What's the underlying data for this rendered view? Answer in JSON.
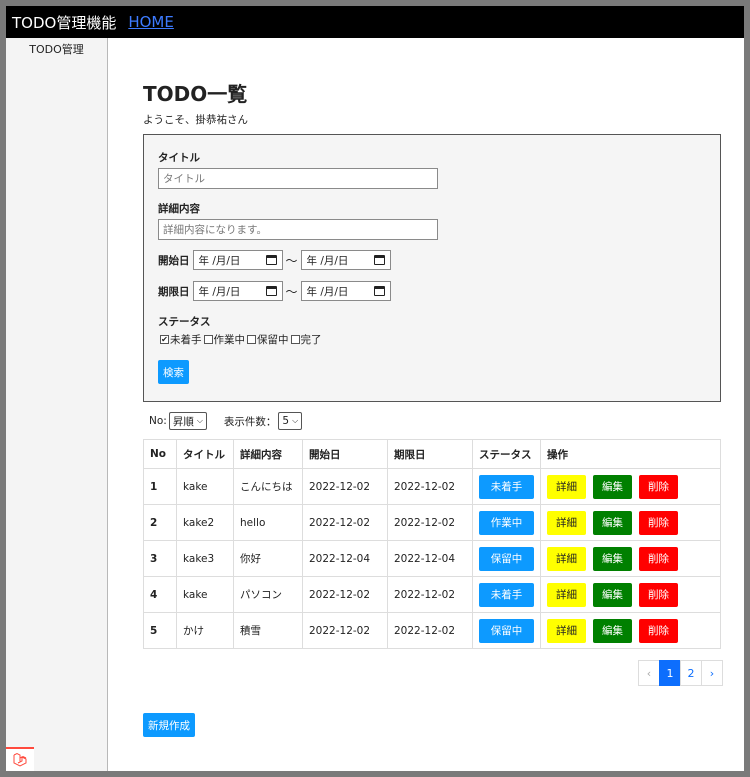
{
  "header": {
    "app_title": "TODO管理機能",
    "home_link": "HOME"
  },
  "sidebar": {
    "items": [
      {
        "label": "TODO管理"
      }
    ]
  },
  "main": {
    "title": "TODO一覧",
    "welcome": "ようこそ、掛恭祐さん"
  },
  "search": {
    "title_label": "タイトル",
    "title_placeholder": "タイトル",
    "detail_label": "詳細内容",
    "detail_placeholder": "詳細内容になります。",
    "start_label": "開始日",
    "due_label": "期限日",
    "date_placeholder": "年 /月/日",
    "tilde": "〜",
    "status_label": "ステータス",
    "statuses": [
      {
        "label": "未着手",
        "checked": true
      },
      {
        "label": "作業中",
        "checked": false
      },
      {
        "label": "保留中",
        "checked": false
      },
      {
        "label": "完了",
        "checked": false
      }
    ],
    "search_button": "検索"
  },
  "controls": {
    "order_label": "No:",
    "order_value": "昇順",
    "count_label": "表示件数：",
    "count_value": "5"
  },
  "table": {
    "headers": [
      "No",
      "タイトル",
      "詳細内容",
      "開始日",
      "期限日",
      "ステータス",
      "操作"
    ],
    "rows": [
      {
        "no": "1",
        "title": "kake",
        "detail": "こんにちは",
        "start": "2022-12-02",
        "due": "2022-12-02",
        "status": "未着手"
      },
      {
        "no": "2",
        "title": "kake2",
        "detail": "hello",
        "start": "2022-12-02",
        "due": "2022-12-02",
        "status": "作業中"
      },
      {
        "no": "3",
        "title": "kake3",
        "detail": "你好",
        "start": "2022-12-04",
        "due": "2022-12-04",
        "status": "保留中"
      },
      {
        "no": "4",
        "title": "kake",
        "detail": "パソコン",
        "start": "2022-12-02",
        "due": "2022-12-02",
        "status": "未着手"
      },
      {
        "no": "5",
        "title": "かけ",
        "detail": "積雪",
        "start": "2022-12-02",
        "due": "2022-12-02",
        "status": "保留中"
      }
    ],
    "detail_button": "詳細",
    "edit_button": "編集",
    "delete_button": "削除"
  },
  "pagination": {
    "prev": "‹",
    "pages": [
      "1",
      "2"
    ],
    "current": "1",
    "next": "›"
  },
  "new_button": "新規作成",
  "colors": {
    "primary": "#0d9aff",
    "detail": "#ffff00",
    "edit": "#008000",
    "delete": "#ff0000",
    "topbar": "#000000"
  }
}
